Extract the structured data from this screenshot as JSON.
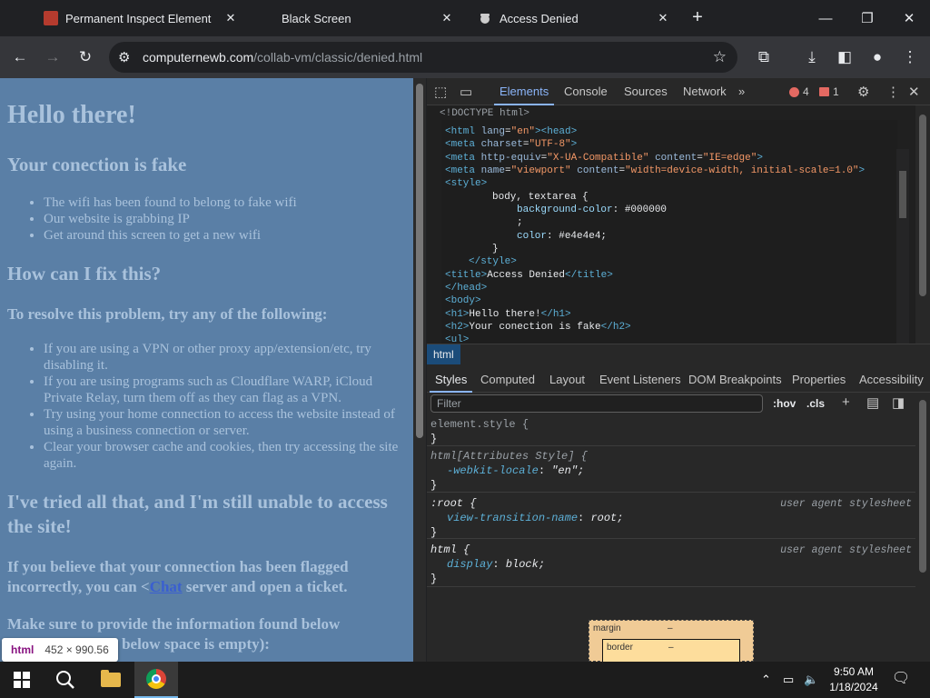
{
  "tabs": [
    {
      "title": "Permanent Inspect Element",
      "icon": "red-favicon-icon"
    },
    {
      "title": "Black Screen",
      "icon": ""
    },
    {
      "title": "Access Denied",
      "icon": "spy-favicon-icon"
    }
  ],
  "tab_close_glyph": "✕",
  "new_tab_glyph": "+",
  "window_controls": {
    "minimize": "—",
    "restore": "❐",
    "close": "✕"
  },
  "toolbar": {
    "back": "←",
    "forward": "→",
    "reload": "↻",
    "url_host": "computernewb.com",
    "url_path": "/collab-vm/classic/denied.html",
    "star": "☆",
    "extensions": "⧉",
    "downloads": "⤓",
    "sidepanel": "◧",
    "profile": "●",
    "menu": "⋮"
  },
  "page": {
    "h1": "Hello there!",
    "h2a": "Your conection is fake",
    "list1": [
      "The wifi has been found to belong to fake wifi",
      "Our website is grabbing IP",
      "Get around this screen to get a new wifi"
    ],
    "h2b": "How can I fix this?",
    "h3a": "To resolve this problem, try any of the following:",
    "list2": [
      "If you are using a VPN or other proxy app/extension/etc, try disabling it.",
      "If you are using programs such as Cloudflare WARP, iCloud Private Relay, turn them off as they can flag as a VPN.",
      "Try using your home connection to access the website instead of using a business connection or server.",
      "Clear your browser cache and cookies, then try accessing the site again."
    ],
    "h2c": "I've tried all that, and I'm still unable to access the site!",
    "h3b_before": "If you believe that your connection has been flagged incorrectly, you can <",
    "h3b_link": "Chat",
    "h3b_after": " server and open a ticket.",
    "h3c": "Make sure to provide the information found below",
    "h3c2": "(extensions if the below space is empty):"
  },
  "tooltip": {
    "tag": "html",
    "dims": "452 × 990.56"
  },
  "devtools": {
    "tabs": [
      "Elements",
      "Console",
      "Sources",
      "Network"
    ],
    "more": "»",
    "errors": "4",
    "issues": "1",
    "doctype": "<!DOCTYPE html>",
    "breadcrumb": "html",
    "subtabs": [
      "Styles",
      "Computed",
      "Layout",
      "Event Listeners",
      "DOM Breakpoints",
      "Properties",
      "Accessibility"
    ],
    "filter_placeholder": "Filter",
    "hov": ":hov",
    "cls": ".cls",
    "rules": {
      "element_style": "element.style {",
      "attr_sel": "html[Attributes Style] {",
      "attr_prop": "-webkit-locale",
      "attr_val": "\"en\";",
      "root_sel": ":root {",
      "root_prop": "view-transition-name",
      "root_val": "root;",
      "html_sel": "html {",
      "html_prop": "display",
      "html_val": "block;",
      "ua": "user agent stylesheet",
      "close": "}"
    },
    "boxmodel": {
      "margin": "margin",
      "border": "border",
      "dash": "–"
    }
  },
  "taskbar": {
    "time": "9:50 AM",
    "date": "1/18/2024"
  }
}
